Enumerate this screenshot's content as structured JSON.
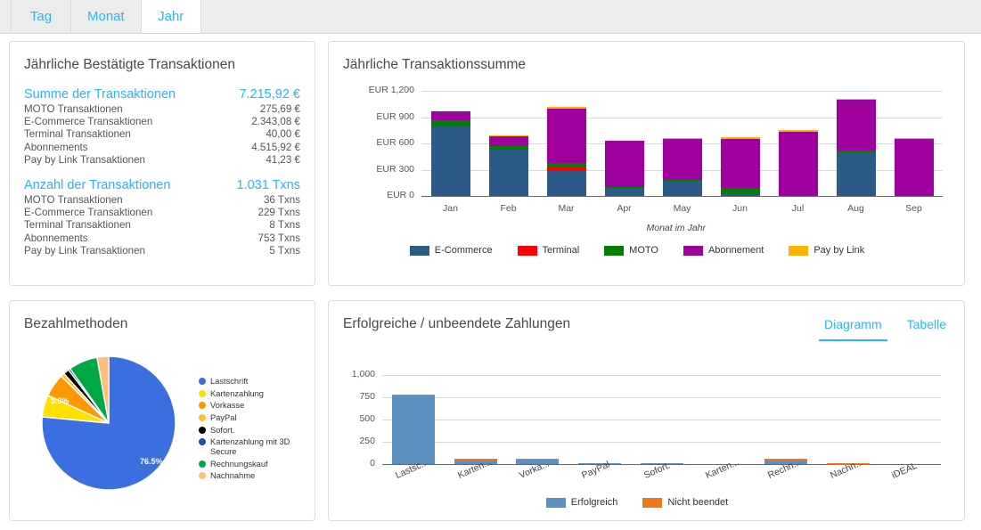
{
  "tabs": [
    {
      "label": "Tag",
      "active": false
    },
    {
      "label": "Monat",
      "active": false
    },
    {
      "label": "Jahr",
      "active": true
    }
  ],
  "cards": {
    "confirmed_title": "Jährliche Bestätigte Transaktionen",
    "sum_title": "Jährliche Transaktionssumme",
    "payment_methods_title": "Bezahlmethoden",
    "payments_title": "Erfolgreiche / unbeendete Zahlungen"
  },
  "summary": {
    "amount": {
      "header_label": "Summe der Transaktionen",
      "header_value": "7.215,92 €",
      "rows": [
        {
          "label": "MOTO Transaktionen",
          "value": "275,69 €"
        },
        {
          "label": "E-Commerce Transaktionen",
          "value": "2.343,08 €"
        },
        {
          "label": "Terminal Transaktionen",
          "value": "40,00 €"
        },
        {
          "label": "Abonnements",
          "value": "4.515,92 €"
        },
        {
          "label": "Pay by Link Transaktionen",
          "value": "41,23 €"
        }
      ]
    },
    "count": {
      "header_label": "Anzahl der Transaktionen",
      "header_value": "1.031 Txns",
      "rows": [
        {
          "label": "MOTO Transaktionen",
          "value": "36 Txns"
        },
        {
          "label": "E-Commerce Transaktionen",
          "value": "229 Txns"
        },
        {
          "label": "Terminal Transaktionen",
          "value": "8 Txns"
        },
        {
          "label": "Abonnements",
          "value": "753 Txns"
        },
        {
          "label": "Pay by Link Transaktionen",
          "value": "5 Txns"
        }
      ]
    }
  },
  "subtabs": [
    {
      "label": "Diagramm",
      "active": true
    },
    {
      "label": "Tabelle",
      "active": false
    }
  ],
  "chart_data": [
    {
      "id": "annual_transaction_sum",
      "type": "bar",
      "stacked": true,
      "title": "Jährliche Transaktionssumme",
      "xlabel": "Monat im Jahr",
      "ylabel": "",
      "ylim": [
        0,
        1200
      ],
      "yticks": [
        0,
        300,
        600,
        900,
        1200
      ],
      "ytick_labels": [
        "EUR 0",
        "EUR 300",
        "EUR 600",
        "EUR 900",
        "EUR 1,200"
      ],
      "categories": [
        "Jan",
        "Feb",
        "Mar",
        "Apr",
        "May",
        "Jun",
        "Jul",
        "Aug",
        "Sep"
      ],
      "legend_position": "bottom",
      "series": [
        {
          "name": "E-Commerce",
          "color": "#2A5A85",
          "values": [
            790,
            530,
            285,
            95,
            160,
            20,
            0,
            500,
            0
          ]
        },
        {
          "name": "Terminal",
          "color": "#FF0000",
          "values": [
            0,
            0,
            40,
            0,
            15,
            0,
            10,
            0,
            0
          ]
        },
        {
          "name": "MOTO",
          "color": "#008000",
          "values": [
            70,
            40,
            55,
            5,
            5,
            70,
            0,
            20,
            0
          ]
        },
        {
          "name": "Abonnement",
          "color": "#A0009E",
          "values": [
            105,
            110,
            620,
            530,
            475,
            565,
            725,
            580,
            650
          ]
        },
        {
          "name": "Pay by Link",
          "color": "#FFB300",
          "values": [
            0,
            15,
            15,
            5,
            5,
            15,
            20,
            10,
            10
          ]
        }
      ]
    },
    {
      "id": "payment_methods",
      "type": "pie",
      "title": "Bezahlmethoden",
      "legend_position": "right",
      "labels": [
        "Lastschrift",
        "Kartenzahlung",
        "Vorkasse",
        "PayPal",
        "Sofort.",
        "Kartenzahlung mit 3D Secure",
        "Rechnungskauf",
        "Nachnahme"
      ],
      "colors": [
        "#3B6FE0",
        "#FFE000",
        "#FF9800",
        "#FFC233",
        "#000000",
        "#1A4FAF",
        "#00A844",
        "#FFBE7A"
      ],
      "values": [
        76.5,
        5.3,
        5.6,
        0.9,
        1.4,
        0.5,
        7.0,
        2.8
      ],
      "visible_data_labels": [
        {
          "label": "76.5%",
          "slice": "Lastschrift"
        },
        {
          "label": "5.3%",
          "slice": "Kartenzahlung"
        }
      ]
    },
    {
      "id": "successful_unfinished_payments",
      "type": "bar",
      "stacked": true,
      "title": "Erfolgreiche / unbeendete Zahlungen",
      "xlabel": "",
      "ylabel": "",
      "ylim": [
        0,
        1000
      ],
      "yticks": [
        0,
        250,
        500,
        750,
        1000
      ],
      "ytick_labels": [
        "0",
        "250",
        "500",
        "750",
        "1,000"
      ],
      "categories": [
        "Lastsc...",
        "Karten...",
        "Vorka...",
        "PayPal",
        "Sofort.",
        "Karten...",
        "Rechn...",
        "Nachn...",
        "iDEAL"
      ],
      "legend_position": "bottom",
      "series": [
        {
          "name": "Erfolgreich",
          "color": "#5B8FC0",
          "values": [
            775,
            42,
            55,
            12,
            12,
            0,
            45,
            5,
            0
          ]
        },
        {
          "name": "Nicht beendet",
          "color": "#F07818",
          "values": [
            5,
            16,
            5,
            2,
            2,
            0,
            14,
            9,
            0
          ]
        }
      ]
    }
  ]
}
